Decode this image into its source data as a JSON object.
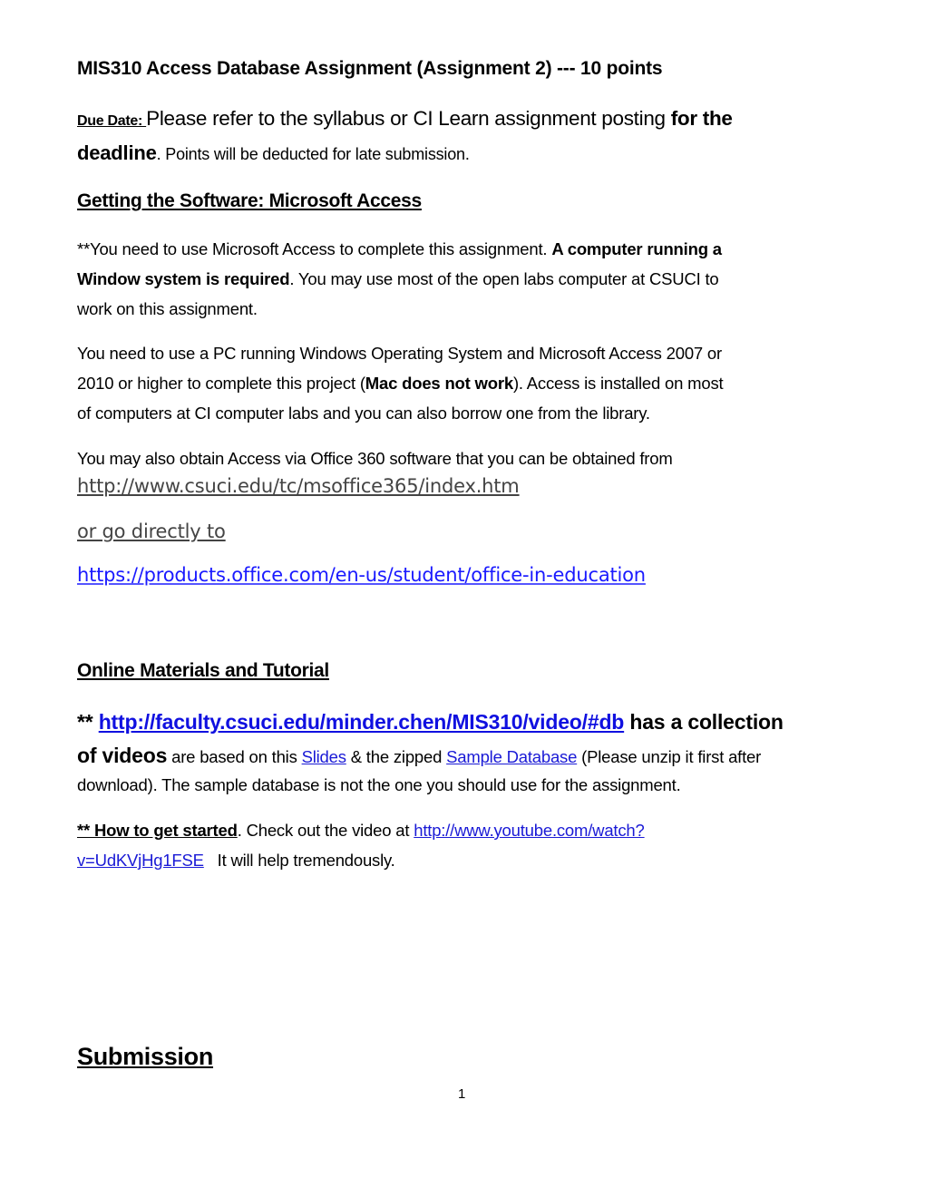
{
  "document": {
    "title": "MIS310  Access Database Assignment (Assignment 2) --- 10 points",
    "due": {
      "label": "Due Date: ",
      "text": "Please refer to the syllabus or CI Learn assignment posting ",
      "bold_tail": "for the",
      "line2_bold": "deadline",
      "line2_text": ". Points will be deducted for late submission."
    },
    "section_software": {
      "heading": "Getting the Software: Microsoft Access",
      "p1": {
        "line1_text": "**You need to use Microsoft Access to complete this assignment.  ",
        "line1_bold": "A computer running a",
        "line2_bold": "Window system is required",
        "line2_text": ".  You may use most of the open labs computer at CSUCI to",
        "line3_text": "work on this assignment."
      },
      "p2": {
        "line1_text": "You need to use a PC running Windows Operating System and Microsoft Access 2007 or",
        "line2_pre": "2010 or higher to complete this project (",
        "line2_bold": "Mac does not work",
        "line2_post": ").  Access is installed on most",
        "line3_text": "of computers at CI computer labs and you can also borrow one from the library."
      },
      "p3": {
        "text": "You may also obtain Access via Office 360 software that you can be obtained from"
      },
      "link_msoffice": "http://www.csuci.edu/tc/msoffice365/index.htm",
      "link_or_go": "or go directly to ",
      "link_products": "https://products.office.com/en-us/student/office-in-education "
    },
    "section_online": {
      "heading": "Online Materials and Tutorial",
      "p4": {
        "stars": "** ",
        "link_faculty": "http://faculty.csuci.edu/minder.chen/MIS310/video/#db",
        "bold_tail": " has a collection",
        "line2_bold": "of videos",
        "line2_text1": " are based on this ",
        "link_slides": "Slides",
        "line2_text2": " & the zipped ",
        "link_sample_db": "Sample Database",
        "line2_text3": " (Please unzip it first after",
        "line3_text": "download).  The sample database is not the one you should use for the assignment."
      },
      "p5": {
        "how_label": "** How to get started",
        "text1": ".  Check out the video at ",
        "link_youtube_1": "http://www.youtube.com/watch?",
        "link_youtube_2": "v=UdKVjHg1FSE",
        "text2": "   It will help tremendously."
      }
    },
    "section_submission": {
      "heading": "Submission"
    },
    "page_number": "1"
  },
  "colors": {
    "link_blue": "#1a1ad6",
    "link_gray": "#444444"
  }
}
